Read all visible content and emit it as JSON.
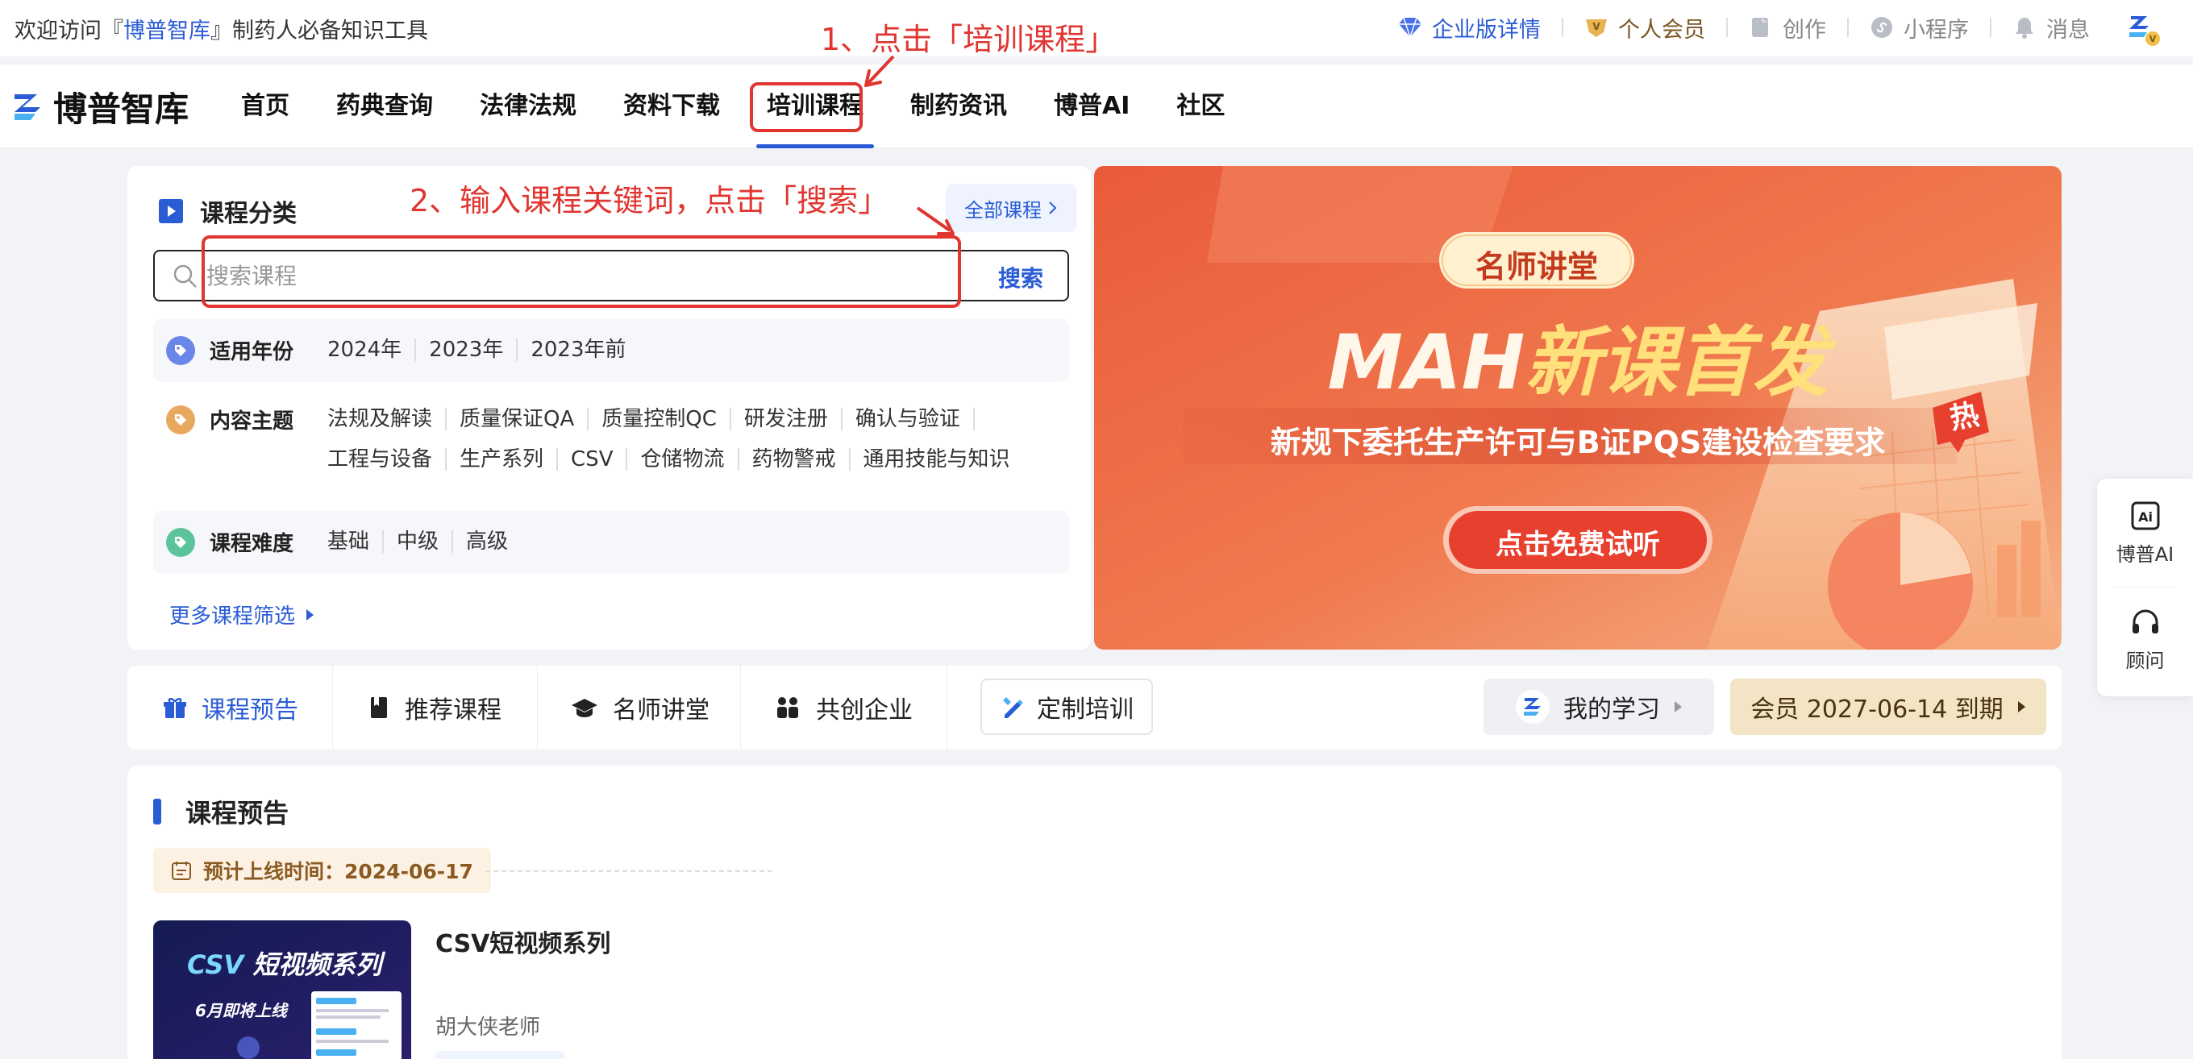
{
  "topbar": {
    "welcome_pre": "欢迎访问『",
    "welcome_brand": "博普智库",
    "welcome_post": "』制药人必备知识工具",
    "links": [
      {
        "label": "企业版详情",
        "icon": "diamond-icon"
      },
      {
        "label": "个人会员",
        "icon": "vip-badge-icon"
      },
      {
        "label": "创作",
        "icon": "edit-doc-icon"
      },
      {
        "label": "小程序",
        "icon": "mini-program-icon"
      },
      {
        "label": "消息",
        "icon": "bell-icon"
      }
    ]
  },
  "nav": {
    "logo_text": "博普智库",
    "items": [
      "首页",
      "药典查询",
      "法律法规",
      "资料下载",
      "培训课程",
      "制药资讯",
      "博普AI",
      "社区"
    ],
    "active": "培训课程"
  },
  "annotations": {
    "step1": "1、点击「培训课程」",
    "step2": "2、输入课程关键词，点击「搜索」"
  },
  "category_panel": {
    "title": "课程分类",
    "all_courses": "全部课程",
    "search_placeholder": "搜索课程",
    "search_button": "搜索",
    "filters": [
      {
        "label": "适用年份",
        "color": "#6a86e8",
        "options": [
          "2024年",
          "2023年",
          "2023年前"
        ]
      },
      {
        "label": "内容主题",
        "color": "#e8a860",
        "options": [
          "法规及解读",
          "质量保证QA",
          "质量控制QC",
          "研发注册",
          "确认与验证",
          "工程与设备",
          "生产系列",
          "CSV",
          "仓储物流",
          "药物警戒",
          "通用技能与知识"
        ]
      },
      {
        "label": "课程难度",
        "color": "#5cc49a",
        "options": [
          "基础",
          "中级",
          "高级"
        ]
      }
    ],
    "more_filters": "更多课程筛选"
  },
  "banner": {
    "badge": "名师讲堂",
    "headline_en": "MAH",
    "headline_cn": "新课首发",
    "subtitle": "新规下委托生产许可与B证PQS建设检查要求",
    "hot": "热",
    "cta": "点击免费试听"
  },
  "side_float": [
    {
      "label": "博普AI",
      "icon": "ai-icon"
    },
    {
      "label": "顾问",
      "icon": "headset-icon"
    }
  ],
  "tabs": {
    "items": [
      {
        "label": "课程预告",
        "icon": "gift-icon"
      },
      {
        "label": "推荐课程",
        "icon": "book-icon"
      },
      {
        "label": "名师讲堂",
        "icon": "graduation-cap-icon"
      },
      {
        "label": "共创企业",
        "icon": "people-icon"
      }
    ],
    "custom_training": "定制培训",
    "my_study": "我的学习",
    "membership": "会员 2027-06-14 到期"
  },
  "preview_section": {
    "title": "课程预告",
    "date_label": "预计上线时间：2024-06-17",
    "course": {
      "title": "CSV短视频系列",
      "teacher": "胡大侠老师",
      "thumb_title_en": "CSV",
      "thumb_title_cn": "短视频系列",
      "thumb_sub": "6月即将上线"
    }
  }
}
